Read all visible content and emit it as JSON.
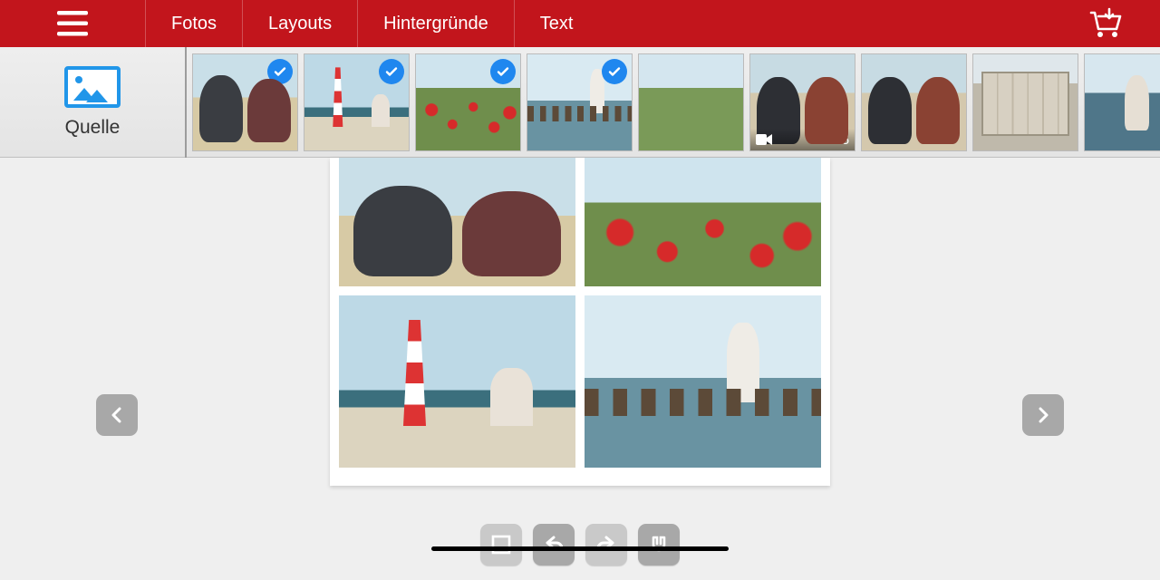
{
  "colors": {
    "brand": "#c2151c",
    "accent": "#1f87ef"
  },
  "nav": {
    "items": [
      {
        "label": "Fotos"
      },
      {
        "label": "Layouts"
      },
      {
        "label": "Hintergründe"
      },
      {
        "label": "Text"
      }
    ]
  },
  "source": {
    "label": "Quelle"
  },
  "thumbnails": [
    {
      "name": "selfie-beach",
      "selected": true,
      "is_video": false,
      "scene": "scene-selfie"
    },
    {
      "name": "lighthouse-bike",
      "selected": true,
      "is_video": false,
      "scene": "scene-lighthouse"
    },
    {
      "name": "poppy-field",
      "selected": true,
      "is_video": false,
      "scene": "scene-poppies"
    },
    {
      "name": "groyne-walk",
      "selected": true,
      "is_video": false,
      "scene": "scene-groyne"
    },
    {
      "name": "grass-sky",
      "selected": false,
      "is_video": false,
      "scene": "scene-grass"
    },
    {
      "name": "selfie-video",
      "selected": false,
      "is_video": true,
      "duration": "0:15",
      "scene": "scene-pair"
    },
    {
      "name": "two-friends",
      "selected": false,
      "is_video": false,
      "scene": "scene-pair"
    },
    {
      "name": "beach-cabin",
      "selected": false,
      "is_video": false,
      "scene": "scene-cabin"
    },
    {
      "name": "portrait-stripes",
      "selected": false,
      "is_video": false,
      "scene": "scene-solo"
    }
  ],
  "page_layout": {
    "cells": [
      {
        "thumb_ref": "selfie-beach",
        "scene": "scene-selfie"
      },
      {
        "thumb_ref": "poppy-field",
        "scene": "scene-poppies"
      },
      {
        "thumb_ref": "lighthouse-bike",
        "scene": "scene-lighthouse"
      },
      {
        "thumb_ref": "groyne-walk",
        "scene": "scene-groyne"
      }
    ]
  },
  "toolbar": {
    "buttons": [
      {
        "name": "fullscreen",
        "enabled": false
      },
      {
        "name": "undo",
        "enabled": true
      },
      {
        "name": "redo",
        "enabled": false
      },
      {
        "name": "snap",
        "enabled": true
      }
    ]
  }
}
